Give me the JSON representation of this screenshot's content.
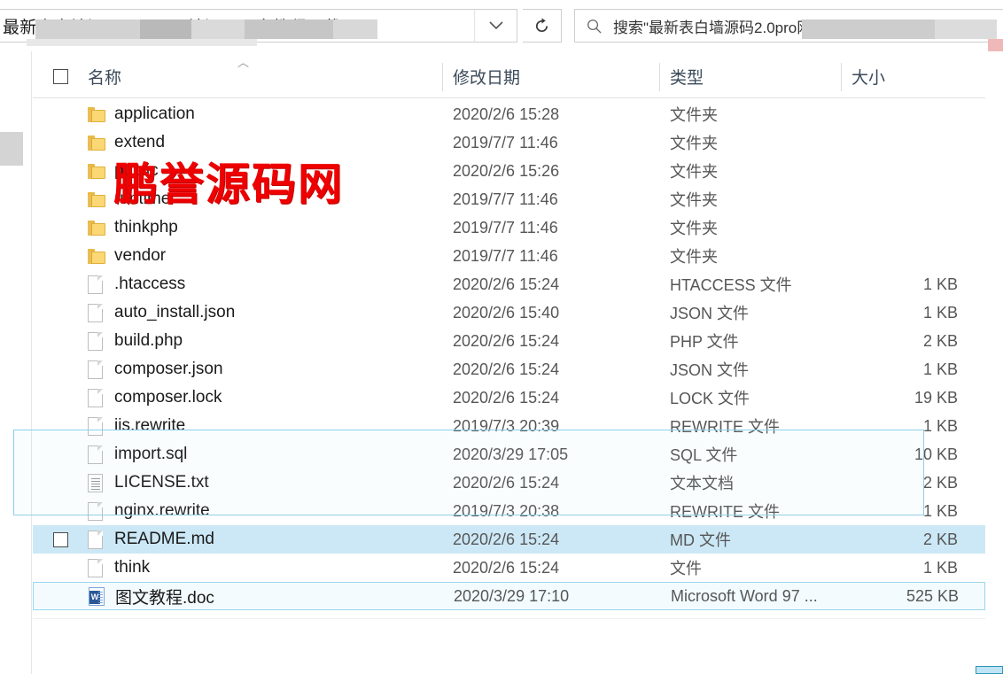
{
  "window": {
    "title": "最新表白墙源码2.0pro网站源码图文教程下载"
  },
  "addressbar": {
    "breadcrumb_text": "最新表白墙源码2.0pro网站源码图文教程下载",
    "breadcrumb_chevron": "❯",
    "dropdown_icon": "chevron-down",
    "dropdown_glyph": "⌄",
    "refresh_glyph": "↻"
  },
  "search": {
    "placeholder": "搜索\"最新表白墙源码2.0pro网站源码图文教程下载\"",
    "icon_glyph": "⌕"
  },
  "columns": {
    "name": "名称",
    "date_modified": "修改日期",
    "type": "类型",
    "size": "大小",
    "sort_caret": "︿"
  },
  "watermark": {
    "text": "鹏誉源码网",
    "color": "#ee0000"
  },
  "selection": {
    "accent": "#cce8f6",
    "marquee_border": "#8fcfe8"
  },
  "files": [
    {
      "name": "application",
      "date": "2020/2/6 15:28",
      "type": "文件夹",
      "size": "",
      "icon": "folder",
      "state": "normal"
    },
    {
      "name": "extend",
      "date": "2019/7/7 11:46",
      "type": "文件夹",
      "size": "",
      "icon": "folder",
      "state": "normal"
    },
    {
      "name": "public",
      "date": "2020/2/6 15:26",
      "type": "文件夹",
      "size": "",
      "icon": "folder",
      "state": "normal"
    },
    {
      "name": "runtime",
      "date": "2019/7/7 11:46",
      "type": "文件夹",
      "size": "",
      "icon": "folder",
      "state": "normal"
    },
    {
      "name": "thinkphp",
      "date": "2019/7/7 11:46",
      "type": "文件夹",
      "size": "",
      "icon": "folder",
      "state": "normal"
    },
    {
      "name": "vendor",
      "date": "2019/7/7 11:46",
      "type": "文件夹",
      "size": "",
      "icon": "folder",
      "state": "normal"
    },
    {
      "name": ".htaccess",
      "date": "2020/2/6 15:24",
      "type": "HTACCESS 文件",
      "size": "1 KB",
      "icon": "doc",
      "state": "normal"
    },
    {
      "name": "auto_install.json",
      "date": "2020/2/6 15:40",
      "type": "JSON 文件",
      "size": "1 KB",
      "icon": "doc",
      "state": "normal"
    },
    {
      "name": "build.php",
      "date": "2020/2/6 15:24",
      "type": "PHP 文件",
      "size": "2 KB",
      "icon": "doc",
      "state": "normal"
    },
    {
      "name": "composer.json",
      "date": "2020/2/6 15:24",
      "type": "JSON 文件",
      "size": "1 KB",
      "icon": "doc",
      "state": "normal"
    },
    {
      "name": "composer.lock",
      "date": "2020/2/6 15:24",
      "type": "LOCK 文件",
      "size": "19 KB",
      "icon": "doc",
      "state": "normal"
    },
    {
      "name": "iis.rewrite",
      "date": "2019/7/3 20:39",
      "type": "REWRITE 文件",
      "size": "1 KB",
      "icon": "doc",
      "state": "normal"
    },
    {
      "name": "import.sql",
      "date": "2020/3/29 17:05",
      "type": "SQL 文件",
      "size": "10 KB",
      "icon": "doc",
      "state": "normal"
    },
    {
      "name": "LICENSE.txt",
      "date": "2020/2/6 15:24",
      "type": "文本文档",
      "size": "2 KB",
      "icon": "txt",
      "state": "normal"
    },
    {
      "name": "nginx.rewrite",
      "date": "2019/7/3 20:38",
      "type": "REWRITE 文件",
      "size": "1 KB",
      "icon": "doc",
      "state": "normal"
    },
    {
      "name": "README.md",
      "date": "2020/2/6 15:24",
      "type": "MD 文件",
      "size": "2 KB",
      "icon": "doc",
      "state": "hover"
    },
    {
      "name": "think",
      "date": "2020/2/6 15:24",
      "type": "文件",
      "size": "1 KB",
      "icon": "doc",
      "state": "normal"
    },
    {
      "name": "图文教程.doc",
      "date": "2020/3/29 17:10",
      "type": "Microsoft Word 97 ...",
      "size": "525 KB",
      "icon": "word",
      "state": "marquee"
    }
  ]
}
